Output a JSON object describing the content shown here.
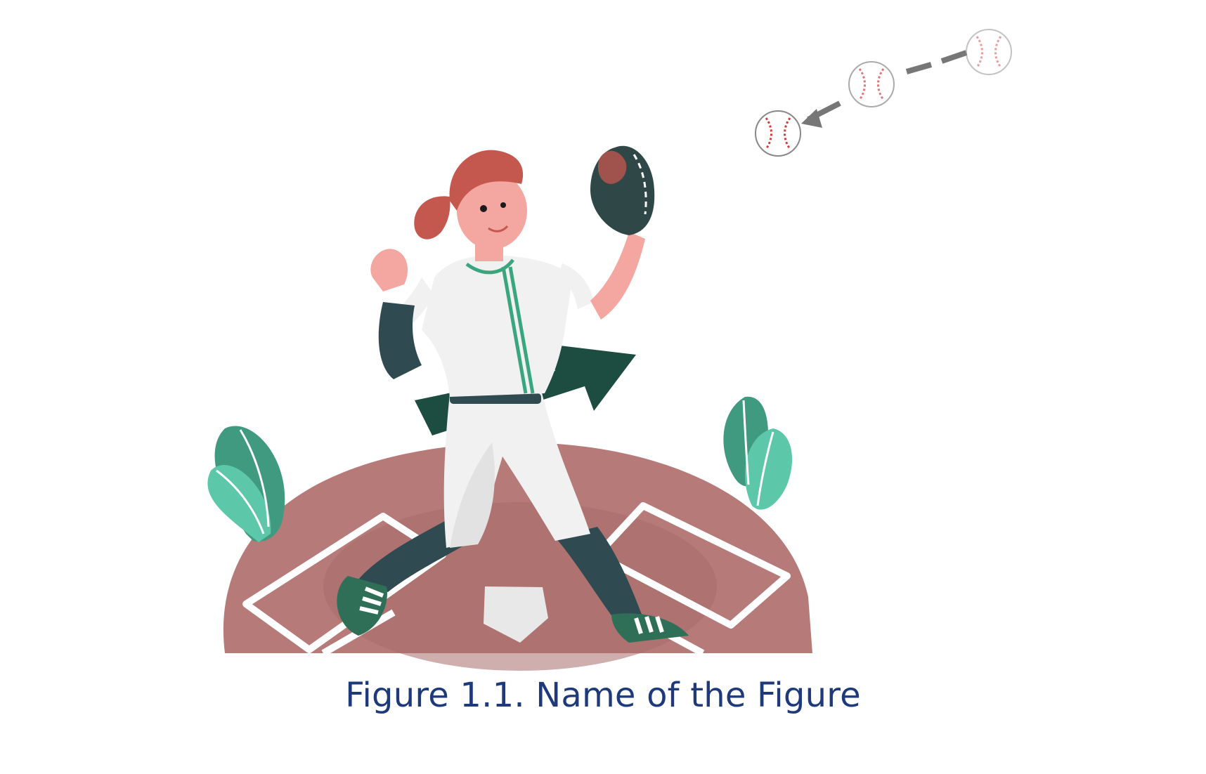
{
  "figure": {
    "caption": "Figure 1.1. Name of the Figure"
  },
  "colors": {
    "caption": "#1f3a7a",
    "field": "#b67a79",
    "field_inner": "#a86d6c",
    "foliage_dark": "#3f9a80",
    "foliage_light": "#5cc7a9",
    "uniform": "#f1f1f1",
    "uniform_stripe": "#3aa67f",
    "sleeve_and_socks": "#2f4b51",
    "cleats": "#2f6f58",
    "arrow": "#1d4c40",
    "glove": "#304747",
    "hair": "#c4584f",
    "skin": "#f4a6a0",
    "ball_stitch": "#d33b3b",
    "trajectory": "#777777"
  }
}
